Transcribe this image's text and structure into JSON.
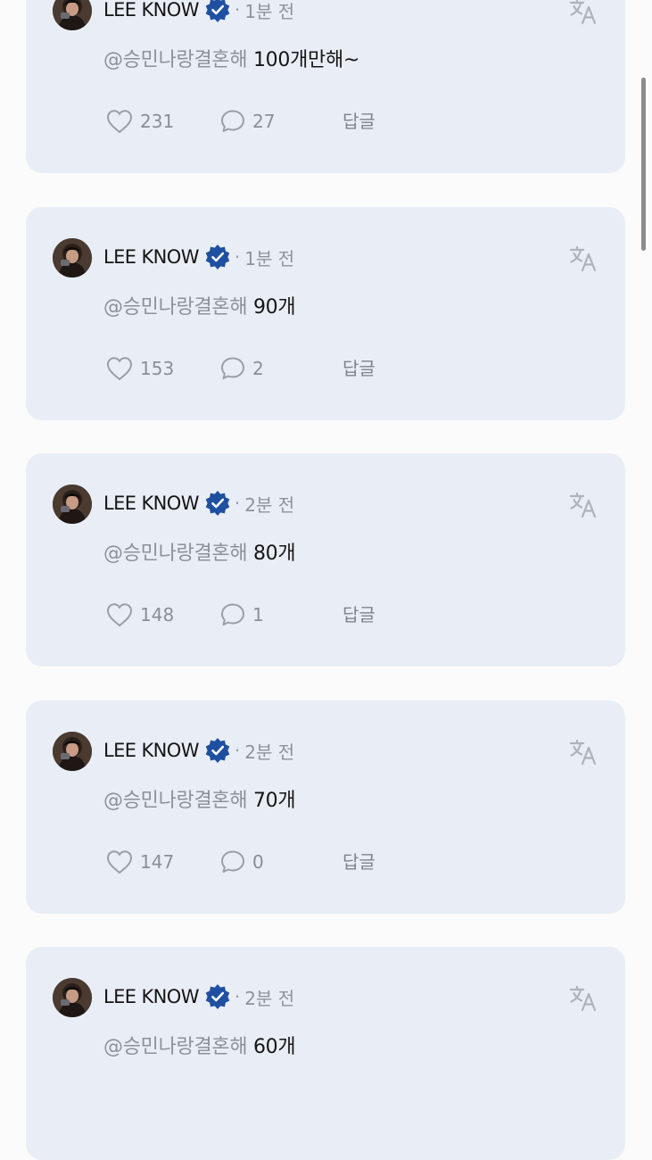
{
  "colors": {
    "card_background": "#e9eef6",
    "page_background": "#fbfbfb",
    "verified_badge": "#1f4fa0",
    "muted_text": "#8c9199"
  },
  "icons": {
    "avatar": "profile-photo",
    "verified": "verified-badge-icon",
    "translate": "translate-icon",
    "like": "heart-outline-icon",
    "comment": "speech-bubble-icon"
  },
  "comments": [
    {
      "author": "LEE KNOW",
      "separator": "·",
      "time": "1분 전",
      "mention": "@승민나랑결혼해",
      "text": "100개만해~",
      "likes": "231",
      "replies": "27",
      "reply_label": "답글"
    },
    {
      "author": "LEE KNOW",
      "separator": "·",
      "time": "1분 전",
      "mention": "@승민나랑결혼해",
      "text": "90개",
      "likes": "153",
      "replies": "2",
      "reply_label": "답글"
    },
    {
      "author": "LEE KNOW",
      "separator": "·",
      "time": "2분 전",
      "mention": "@승민나랑결혼해",
      "text": "80개",
      "likes": "148",
      "replies": "1",
      "reply_label": "답글"
    },
    {
      "author": "LEE KNOW",
      "separator": "·",
      "time": "2분 전",
      "mention": "@승민나랑결혼해",
      "text": "70개",
      "likes": "147",
      "replies": "0",
      "reply_label": "답글"
    },
    {
      "author": "LEE KNOW",
      "separator": "·",
      "time": "2분 전",
      "mention": "@승민나랑결혼해",
      "text": "60개",
      "likes": "",
      "replies": "",
      "reply_label": ""
    }
  ]
}
